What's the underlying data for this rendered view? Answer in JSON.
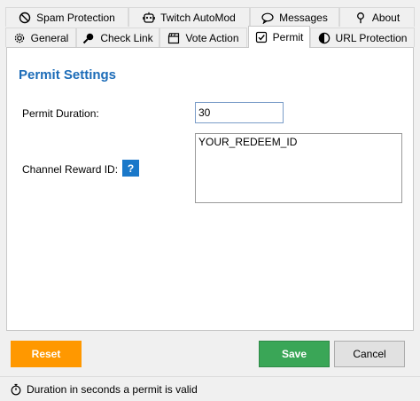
{
  "tabs_top": [
    {
      "label": "Spam Protection",
      "icon": "block-icon"
    },
    {
      "label": "Twitch AutoMod",
      "icon": "robot-icon"
    },
    {
      "label": "Messages",
      "icon": "chat-bubble-icon"
    },
    {
      "label": "About",
      "icon": "pin-icon"
    }
  ],
  "tabs_bottom": [
    {
      "label": "General",
      "icon": "gear-icon"
    },
    {
      "label": "Check Link",
      "icon": "magnifier-icon"
    },
    {
      "label": "Vote Action",
      "icon": "clapperboard-icon"
    },
    {
      "label": "Permit",
      "icon": "checkbox-icon",
      "active": true
    },
    {
      "label": "URL Protection",
      "icon": "shield-icon"
    }
  ],
  "section": {
    "title": "Permit Settings"
  },
  "permit_duration": {
    "label": "Permit Duration:",
    "value": "30"
  },
  "channel_reward": {
    "label": "Channel Reward ID:",
    "value": "YOUR_REDEEM_ID",
    "help": "?"
  },
  "buttons": {
    "reset": "Reset",
    "save": "Save",
    "cancel": "Cancel"
  },
  "colors": {
    "accent": "#1c6cb8",
    "reset": "#ff9800",
    "save": "#3aa657",
    "help": "#1a78c9"
  },
  "status": {
    "text": "Duration in seconds a permit is valid",
    "icon": "stopwatch-icon"
  }
}
